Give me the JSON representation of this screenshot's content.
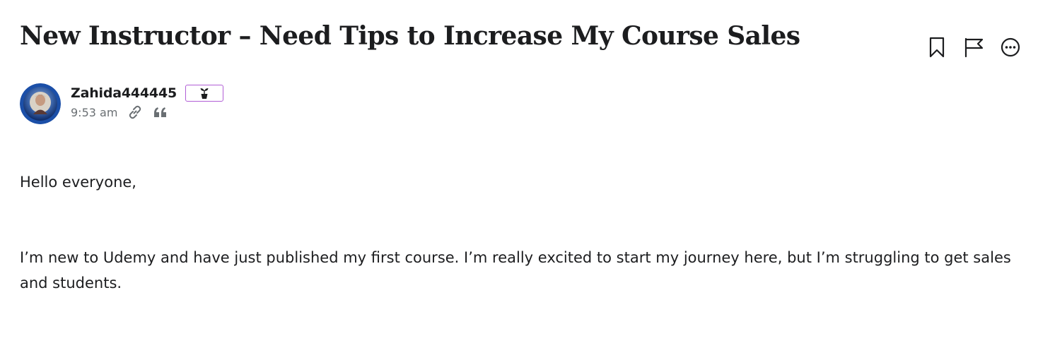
{
  "post": {
    "title": "New Instructor – Need Tips to Increase My Course Sales",
    "author": {
      "name": "Zahida444445",
      "badge_icon": "sprout-icon",
      "badge_color": "#b15ed6"
    },
    "time": "9:53 am",
    "meta_icons": [
      "link-icon",
      "quote-icon"
    ],
    "actions": [
      "bookmark-icon",
      "flag-icon",
      "more-options-icon"
    ],
    "body": [
      "Hello everyone,",
      "I’m new to Udemy and have just published my first course. I’m really excited to start my journey here, but I’m struggling to get sales and students."
    ]
  },
  "colors": {
    "text": "#1c1d1f",
    "muted": "#6a6f73",
    "badge_border": "#b15ed6",
    "avatar_ring": "#1b4fa8"
  }
}
